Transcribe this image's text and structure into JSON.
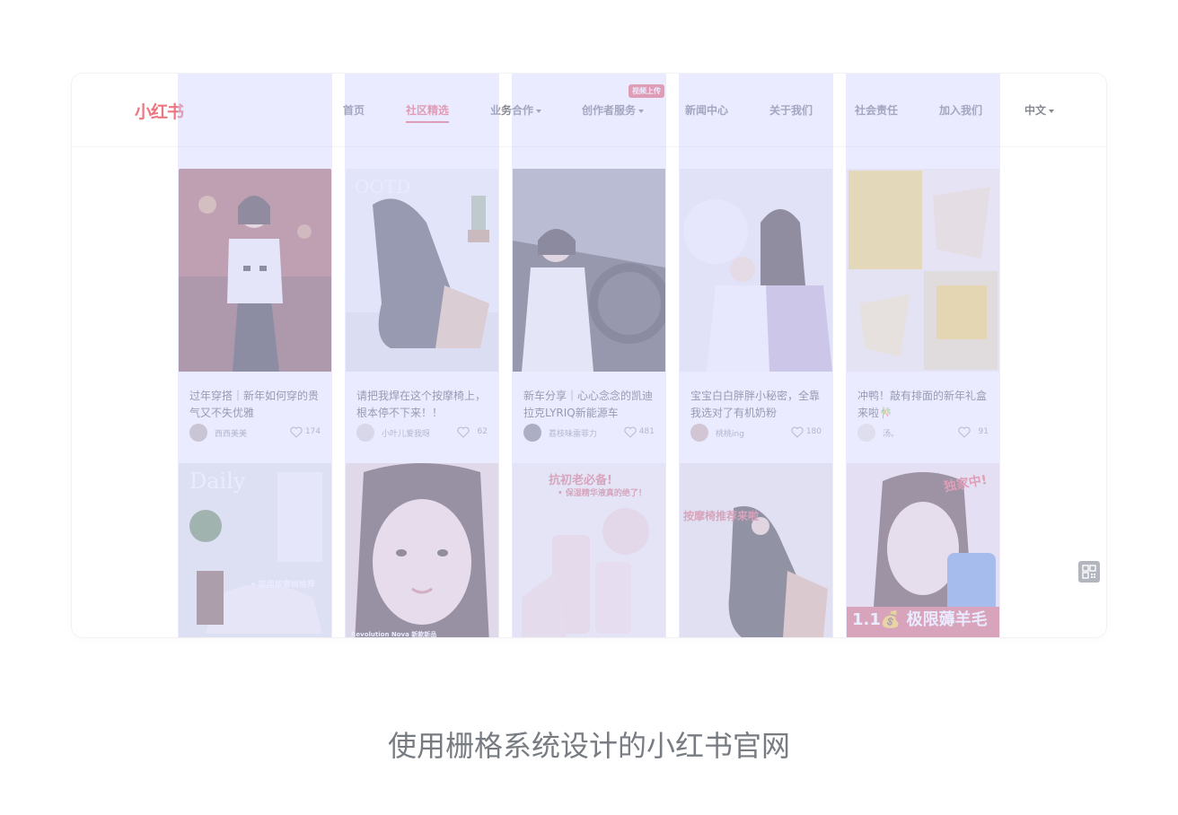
{
  "brand": {
    "logo_text": "小红书",
    "accent": "#e5434f"
  },
  "nav": {
    "items": [
      {
        "label": "首页",
        "dropdown": false
      },
      {
        "label": "社区精选",
        "dropdown": false,
        "active": true
      },
      {
        "label": "业务合作",
        "dropdown": true
      },
      {
        "label": "创作者服务",
        "dropdown": true,
        "badge": "视频上传"
      },
      {
        "label": "新闻中心",
        "dropdown": false
      },
      {
        "label": "关于我们",
        "dropdown": false
      },
      {
        "label": "社会责任",
        "dropdown": false
      },
      {
        "label": "加入我们",
        "dropdown": false
      },
      {
        "label": "中文",
        "dropdown": true
      }
    ]
  },
  "feed": {
    "row1": [
      {
        "title": "过年穿搭｜新年如何穿的贵气又不失优雅",
        "author": "西西美美",
        "likes": "174"
      },
      {
        "title": "请把我焊在这个按摩椅上，根本停不下来！！",
        "author": "小叶儿爱我呀",
        "likes": "62",
        "overlay": "OOTD"
      },
      {
        "title": "新车分享｜心心念念的凯迪拉克LYRIQ新能源车",
        "author": "荔枝味雷菲力",
        "likes": "481"
      },
      {
        "title": "宝宝白白胖胖小秘密，全靠我选对了有机奶粉",
        "author": "桃桃ing",
        "likes": "180"
      },
      {
        "title": "冲鸭！敲有排面的新年礼盒来啦🎋",
        "author": "汤。",
        "likes": "91"
      }
    ],
    "row2": [
      {
        "overlay_top": "Daily",
        "overlay_bottom": "• 家用按摩椅推荐"
      },
      {
        "overlay_bottom": "Revolution Nova 新款新品"
      },
      {
        "overlay_top": "抗初老必备!",
        "overlay_mid": "• 保湿精华液真的绝了！"
      },
      {
        "overlay_top": "按摩椅推荐来啦"
      },
      {
        "overlay_top": "独家中!",
        "overlay_bottom": "1.1💰 极限薅羊毛"
      }
    ]
  },
  "caption": "使用栅格系统设计的小红书官网"
}
